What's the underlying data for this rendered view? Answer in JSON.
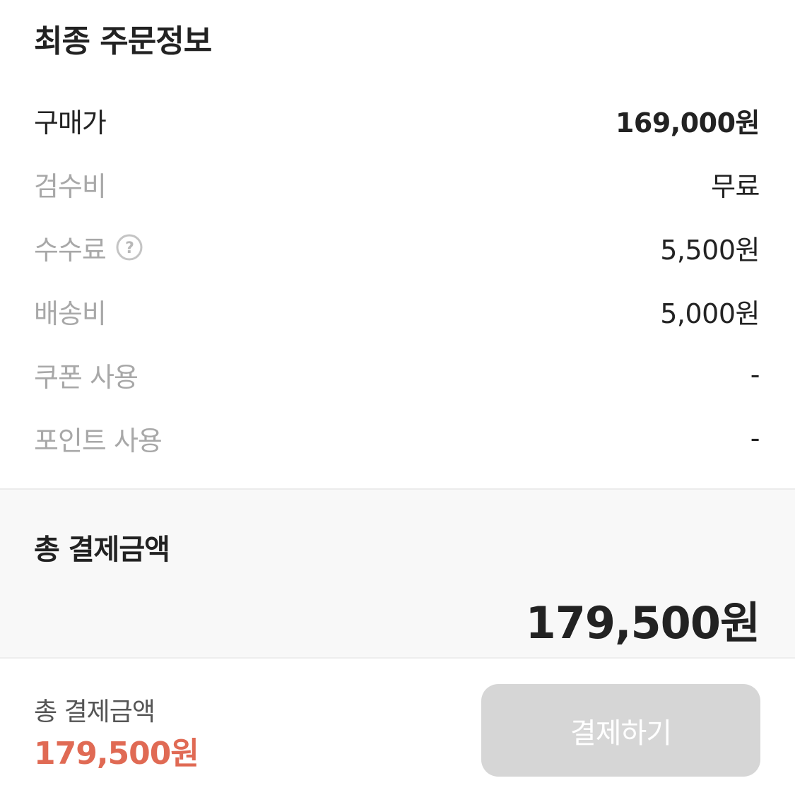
{
  "order_info": {
    "title": "최종 주문정보",
    "rows": [
      {
        "label": "구매가",
        "value": "169,000원"
      },
      {
        "label": "검수비",
        "value": "무료"
      },
      {
        "label": "수수료",
        "value": "5,500원"
      },
      {
        "label": "배송비",
        "value": "5,000원"
      },
      {
        "label": "쿠폰 사용",
        "value": "-"
      },
      {
        "label": "포인트 사용",
        "value": "-"
      }
    ],
    "help_icon": "question-circle-icon"
  },
  "total": {
    "label": "총 결제금액",
    "amount": "179,500원"
  },
  "bottom_bar": {
    "label": "총 결제금액",
    "amount": "179,500원",
    "pay_button_label": "결제하기"
  },
  "colors": {
    "accent": "#e06a54",
    "button_disabled": "#d6d6d6",
    "muted_text": "#a8a8a8",
    "panel_bg": "#f8f8f8"
  }
}
